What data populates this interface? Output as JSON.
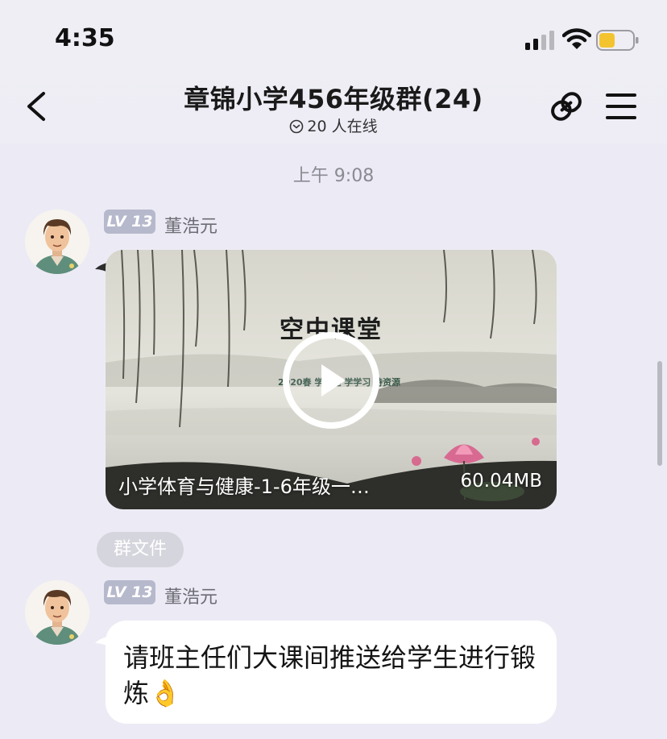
{
  "status_bar": {
    "time": "4:35"
  },
  "header": {
    "title": "章锦小学456年级群(24)",
    "online_text": "20 人在线"
  },
  "messages": {
    "timestamp": "上午 9:08",
    "first": {
      "level_badge": "LV 13",
      "sender": "董浩元",
      "video": {
        "cover_title": "空中课堂",
        "cover_subtitle": "2020春  学期延  学学习  持资源",
        "filename": "小学体育与健康-1-6年级一…",
        "size": "60.04MB"
      },
      "tag": "群文件"
    },
    "second": {
      "level_badge": "LV 13",
      "sender": "董浩元",
      "text": "请班主任们大课间推送给学生进行锻炼👌"
    }
  },
  "colors": {
    "background": "#ecebf5",
    "badge": "#b6b9cc",
    "tag_bg": "#d5d5dd",
    "bubble": "#ffffff"
  },
  "icons": {
    "back": "chevron-left-icon",
    "online": "online-status-icon",
    "link": "link-icon",
    "menu": "hamburger-menu-icon",
    "play": "play-icon"
  }
}
